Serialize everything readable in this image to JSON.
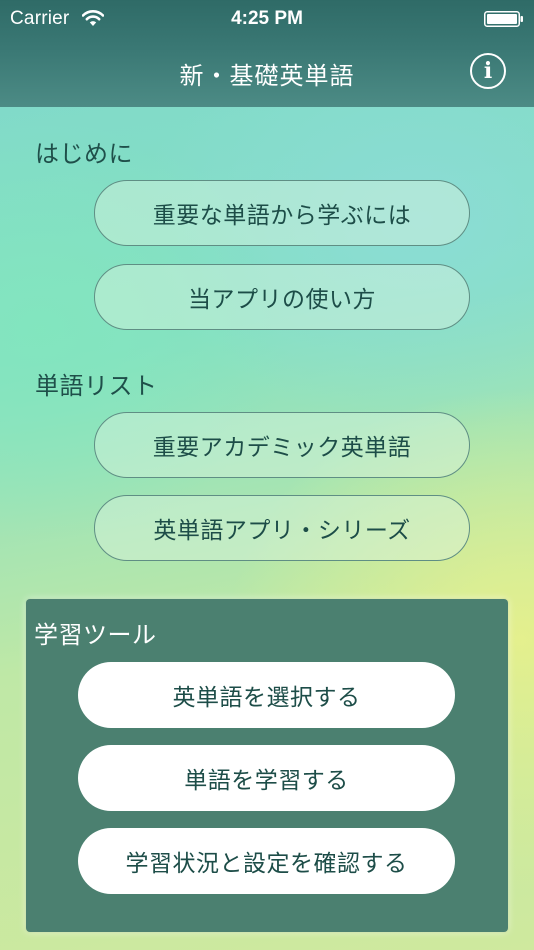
{
  "status_bar": {
    "carrier": "Carrier",
    "time": "4:25 PM",
    "icons": [
      "wifi-icon",
      "battery-icon"
    ]
  },
  "nav": {
    "title": "新・基礎英単語",
    "info_symbol": "i",
    "info_icon": "info-circle-icon"
  },
  "intro": {
    "label": "はじめに",
    "buttons": [
      "重要な単語から学ぶには",
      "当アプリの使い方"
    ]
  },
  "word_list": {
    "label": "単語リスト",
    "buttons": [
      "重要アカデミック英単語",
      "英単語アプリ・シリーズ"
    ]
  },
  "tools": {
    "label": "学習ツール",
    "buttons": [
      "英単語を選択する",
      "単語を学習する",
      "学習状況と設定を確認する"
    ]
  },
  "colors": {
    "header": "#3a7874",
    "panel": "#4b8070",
    "text": "#1d4d48"
  }
}
